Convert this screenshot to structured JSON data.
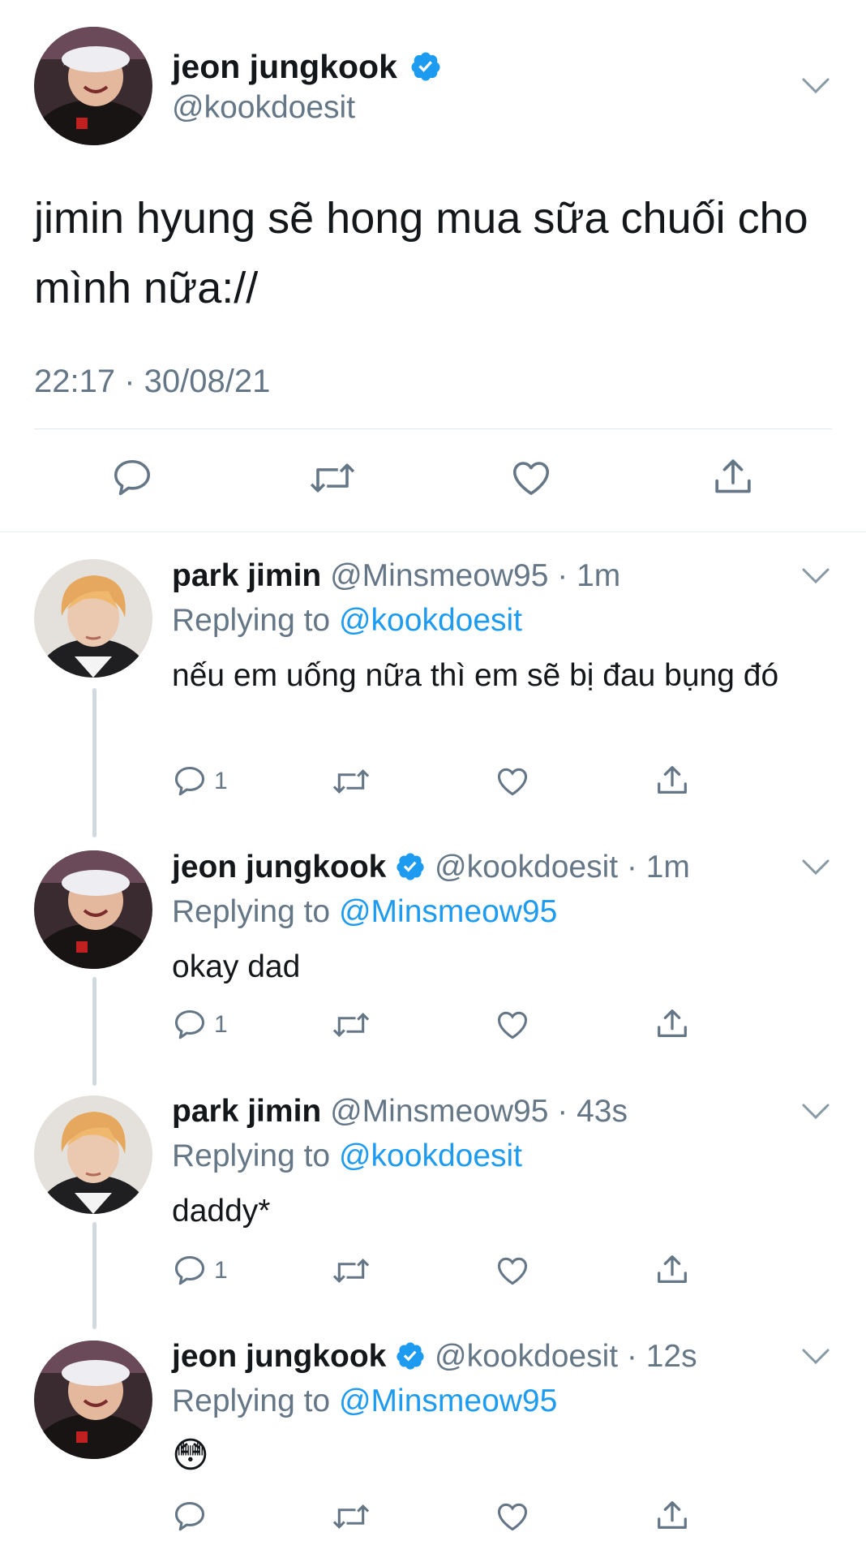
{
  "main_tweet": {
    "display_name": "jeon jungkook",
    "handle": "@kookdoesit",
    "text": "jimin hyung sẽ hong mua sữa chuối cho mình nữa://",
    "timestamp": "22:17 · 30/08/21"
  },
  "replies": [
    {
      "display_name": "park jimin",
      "handle": "@Minsmeow95",
      "time": "· 1m",
      "replying_label": "Replying to",
      "replying_to": "@kookdoesit",
      "text": "nếu em uống nữa thì em sẽ bị đau bụng đó",
      "reply_count": "1",
      "verified": false
    },
    {
      "display_name": "jeon jungkook",
      "handle": "@kookdoesit",
      "time": "· 1m",
      "replying_label": "Replying to",
      "replying_to": "@Minsmeow95",
      "text": "okay dad",
      "reply_count": "1",
      "verified": true
    },
    {
      "display_name": "park jimin",
      "handle": "@Minsmeow95",
      "time": "· 43s",
      "replying_label": "Replying to",
      "replying_to": "@kookdoesit",
      "text": "daddy*",
      "reply_count": "1",
      "verified": false
    },
    {
      "display_name": "jeon jungkook",
      "handle": "@kookdoesit",
      "time": "· 12s",
      "replying_label": "Replying to",
      "replying_to": "@Minsmeow95",
      "text": "😳",
      "reply_count": "",
      "verified": true
    }
  ],
  "colors": {
    "link_blue": "#1d9bf0",
    "secondary_text": "#657786",
    "icon_gray": "#657786",
    "thread_line": "#cfd9de"
  },
  "icons": {
    "reply": "speech-bubble-icon",
    "retweet": "retweet-icon",
    "like": "heart-icon",
    "share": "share-icon",
    "verified": "verified-badge-icon",
    "more": "chevron-down-icon"
  }
}
